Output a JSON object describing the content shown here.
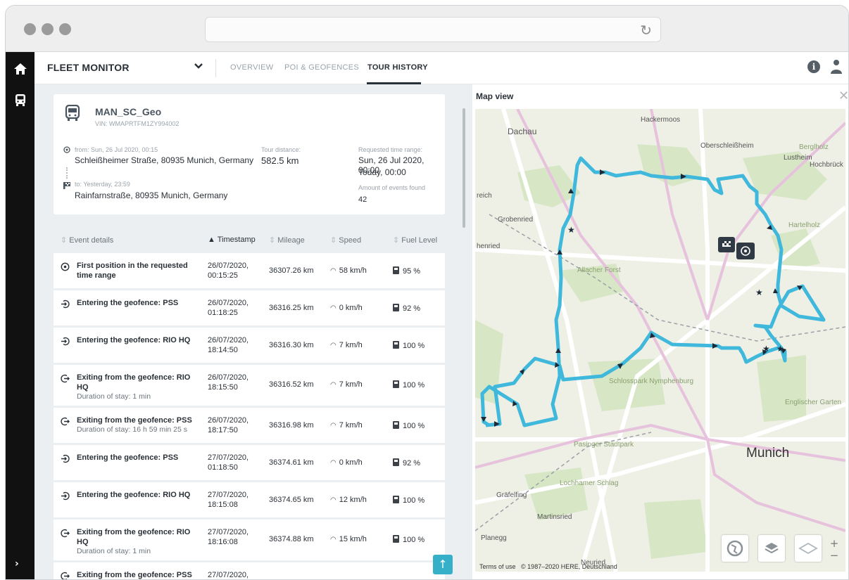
{
  "app": {
    "title": "FLEET MONITOR"
  },
  "nav": {
    "tabs": [
      "OVERVIEW",
      "POI & GEOFENCES",
      "TOUR HISTORY"
    ],
    "active": "TOUR HISTORY"
  },
  "vehicle": {
    "name": "MAN_SC_Geo",
    "vin": "VIN: WMAPRTFM1ZY994002",
    "from_label": "from: Sun, 26 Jul 2020, 00:15",
    "from_address": "Schleißheimer Straße, 80935 Munich, Germany",
    "to_label": "to: Yesterday, 23:59",
    "to_address": "Rainfarnstraße, 80935 Munich, Germany",
    "distance_label": "Tour distance:",
    "distance_value": "582.5 km",
    "range_label": "Requested time range:",
    "range_start": "Sun, 26 Jul 2020, 00:00",
    "range_end": "Today, 00:00",
    "events_label": "Amount of events found",
    "events_value": "42"
  },
  "table": {
    "headers": {
      "event": "Event details",
      "timestamp": "Timestamp",
      "mileage": "Mileage",
      "speed": "Speed",
      "fuel": "Fuel Level"
    },
    "rows": [
      {
        "title": "First position in the requested time range",
        "sub": "",
        "ts1": "26/07/2020,",
        "ts2": "00:15:25",
        "mileage": "36307.26 km",
        "speed": "58 km/h",
        "fuel": "95 %"
      },
      {
        "title": "Entering the geofence: PSS",
        "sub": "",
        "ts1": "26/07/2020,",
        "ts2": "01:18:25",
        "mileage": "36316.25 km",
        "speed": "0 km/h",
        "fuel": "92 %"
      },
      {
        "title": "Entering the geofence: RIO HQ",
        "sub": "",
        "ts1": "26/07/2020,",
        "ts2": "18:14:50",
        "mileage": "36316.30 km",
        "speed": "7 km/h",
        "fuel": "100 %"
      },
      {
        "title": "Exiting from the geofence: RIO HQ",
        "sub": "Duration of stay: 1 min",
        "ts1": "26/07/2020,",
        "ts2": "18:15:50",
        "mileage": "36316.52 km",
        "speed": "7 km/h",
        "fuel": "100 %"
      },
      {
        "title": "Exiting from the geofence: PSS",
        "sub": "Duration of stay: 16 h 59 min 25 s",
        "ts1": "26/07/2020,",
        "ts2": "18:17:50",
        "mileage": "36316.98 km",
        "speed": "7 km/h",
        "fuel": "100 %"
      },
      {
        "title": "Entering the geofence: PSS",
        "sub": "",
        "ts1": "27/07/2020,",
        "ts2": "01:18:50",
        "mileage": "36374.61 km",
        "speed": "0 km/h",
        "fuel": "92 %"
      },
      {
        "title": "Entering the geofence: RIO HQ",
        "sub": "",
        "ts1": "27/07/2020,",
        "ts2": "18:15:08",
        "mileage": "36374.65 km",
        "speed": "12 km/h",
        "fuel": "100 %"
      },
      {
        "title": "Exiting from the geofence: RIO HQ",
        "sub": "Duration of stay: 1 min",
        "ts1": "27/07/2020,",
        "ts2": "18:16:08",
        "mileage": "36374.88 km",
        "speed": "15 km/h",
        "fuel": "100 %"
      },
      {
        "title": "Exiting from the geofence: PSS",
        "sub": "",
        "ts1": "27/07/2020,",
        "ts2": "",
        "mileage": "",
        "speed": "",
        "fuel": ""
      }
    ]
  },
  "map": {
    "title": "Map view",
    "labels": {
      "hackermoos": "Hackermoos",
      "dachau": "Dachau",
      "oberschleissheim": "Oberschleißheim",
      "lustheim": "Lustheim",
      "hochbrueck": "Hochbrück",
      "berglholz": "Berglholz",
      "reich": "reich",
      "grobenried": "Grobenried",
      "henried": "henried",
      "hartelholz": "Hartelholz",
      "allacher_forst": "Allacher Forst",
      "schlosspark": "Schlosspark Nymphenburg",
      "englischer": "Englischer Garten",
      "munich": "Munich",
      "graefelfing": "Gräfelfing",
      "martinsried": "Martinsried",
      "planegg": "Planegg",
      "pasinger": "Pasinger Stadtpark",
      "lochhamer": "Lochhamer Schlag",
      "neuried": "Neuried"
    },
    "attribution_terms": "Terms of use",
    "attribution": "© 1987–2020 HERE, Deutschland",
    "zoom_in": "+",
    "zoom_out": "−"
  },
  "colors": {
    "route": "#3fb8dc",
    "accent": "#36b0c9",
    "sidebar": "#111111"
  }
}
